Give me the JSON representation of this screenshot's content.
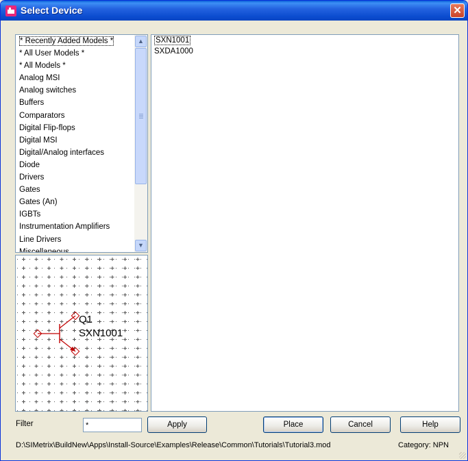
{
  "window": {
    "title": "Select Device",
    "close_glyph": "✕"
  },
  "categories": {
    "items": [
      "* Recently Added Models *",
      "* All User Models *",
      "* All Models *",
      "Analog MSI",
      "Analog switches",
      "Buffers",
      "Comparators",
      "Digital Flip-flops",
      "Digital MSI",
      "Digital/Analog interfaces",
      "Diode",
      "Drivers",
      "Gates",
      "Gates (An)",
      "IGBTs",
      "Instrumentation Amplifiers",
      "Line Drivers",
      "Miscellaneous"
    ],
    "selected_index": 0,
    "scroll_up_glyph": "▲",
    "scroll_down_glyph": "▼"
  },
  "devices": {
    "items": [
      "SXN1001",
      "SXDA1000"
    ],
    "selected_index": 0
  },
  "preview": {
    "ref_label": "Q1",
    "model_label": "SXN1001"
  },
  "filter": {
    "label": "Filter",
    "value": "*"
  },
  "buttons": {
    "apply": "Apply",
    "place": "Place",
    "cancel": "Cancel",
    "help": "Help"
  },
  "status": {
    "path": "D:\\SIMetrix\\BuildNew\\Apps\\Install-Source\\Examples\\Release\\Common\\Tutorials\\Tutorial3.mod",
    "category": "Category: NPN"
  },
  "icons": {
    "app": "simetrix-app-icon",
    "close": "close-icon"
  }
}
